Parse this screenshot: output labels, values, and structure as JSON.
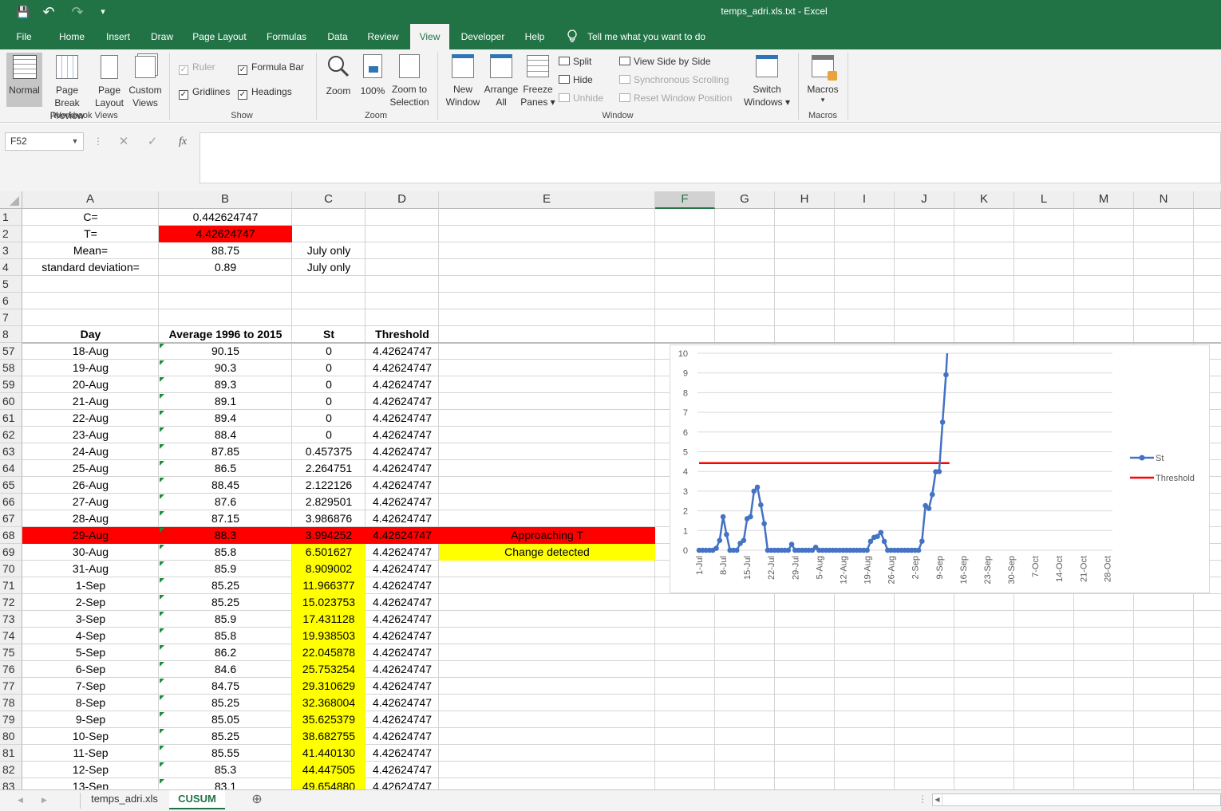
{
  "window": {
    "title": "temps_adri.xls.txt  -  Excel"
  },
  "qat": {
    "save": "💾",
    "undo": "↶",
    "redo": "↷",
    "customize": "▾"
  },
  "tabs": [
    "File",
    "Home",
    "Insert",
    "Draw",
    "Page Layout",
    "Formulas",
    "Data",
    "Review",
    "View",
    "Developer",
    "Help"
  ],
  "tell_me": "Tell me what you want to do",
  "ribbon": {
    "workbook_views": {
      "normal": "Normal",
      "page_break_1": "Page Break",
      "page_break_2": "Preview",
      "page_layout_1": "Page",
      "page_layout_2": "Layout",
      "custom_1": "Custom",
      "custom_2": "Views",
      "label": "Workbook Views"
    },
    "show": {
      "ruler": "Ruler",
      "formula_bar": "Formula Bar",
      "gridlines": "Gridlines",
      "headings": "Headings",
      "label": "Show"
    },
    "zoom": {
      "zoom": "Zoom",
      "hundred": "100%",
      "zoom_sel_1": "Zoom to",
      "zoom_sel_2": "Selection",
      "label": "Zoom"
    },
    "window": {
      "new_1": "New",
      "new_2": "Window",
      "arrange_1": "Arrange",
      "arrange_2": "All",
      "freeze_1": "Freeze",
      "freeze_2": "Panes ▾",
      "split": "Split",
      "hide": "Hide",
      "unhide": "Unhide",
      "side_by_side": "View Side by Side",
      "sync_scroll": "Synchronous Scrolling",
      "reset_pos": "Reset Window Position",
      "switch_1": "Switch",
      "switch_2": "Windows ▾",
      "label": "Window"
    },
    "macros": {
      "macros": "Macros",
      "arrow": "▾",
      "label": "Macros"
    }
  },
  "formula_bar": {
    "name_box": "F52",
    "cancel": "✕",
    "enter": "✓",
    "fx": "fx",
    "value": ""
  },
  "columns": [
    "A",
    "B",
    "C",
    "D",
    "E",
    "F",
    "G",
    "H",
    "I",
    "J",
    "K",
    "L",
    "M",
    "N"
  ],
  "top_rows": [
    {
      "n": "1",
      "a": "C=",
      "b": "0.442624747",
      "c": "",
      "d": ""
    },
    {
      "n": "2",
      "a": "T=",
      "b": "4.42624747",
      "c": "",
      "d": ""
    },
    {
      "n": "3",
      "a": "Mean=",
      "b": "88.75",
      "c": "July only",
      "d": ""
    },
    {
      "n": "4",
      "a": "standard deviation=",
      "b": "0.89",
      "c": "July only",
      "d": ""
    },
    {
      "n": "5",
      "a": "",
      "b": "",
      "c": "",
      "d": ""
    },
    {
      "n": "6",
      "a": "",
      "b": "",
      "c": "",
      "d": ""
    },
    {
      "n": "7",
      "a": "",
      "b": "",
      "c": "",
      "d": ""
    },
    {
      "n": "8",
      "a": "Day",
      "b": "Average 1996 to 2015",
      "c": "St",
      "d": "Threshold"
    }
  ],
  "data_rows": [
    {
      "n": "57",
      "a": "18-Aug",
      "b": "90.15",
      "c": "0",
      "d": "4.42624747",
      "e": ""
    },
    {
      "n": "58",
      "a": "19-Aug",
      "b": "90.3",
      "c": "0",
      "d": "4.42624747",
      "e": ""
    },
    {
      "n": "59",
      "a": "20-Aug",
      "b": "89.3",
      "c": "0",
      "d": "4.42624747",
      "e": ""
    },
    {
      "n": "60",
      "a": "21-Aug",
      "b": "89.1",
      "c": "0",
      "d": "4.42624747",
      "e": ""
    },
    {
      "n": "61",
      "a": "22-Aug",
      "b": "89.4",
      "c": "0",
      "d": "4.42624747",
      "e": ""
    },
    {
      "n": "62",
      "a": "23-Aug",
      "b": "88.4",
      "c": "0",
      "d": "4.42624747",
      "e": ""
    },
    {
      "n": "63",
      "a": "24-Aug",
      "b": "87.85",
      "c": "0.457375",
      "d": "4.42624747",
      "e": ""
    },
    {
      "n": "64",
      "a": "25-Aug",
      "b": "86.5",
      "c": "2.264751",
      "d": "4.42624747",
      "e": ""
    },
    {
      "n": "65",
      "a": "26-Aug",
      "b": "88.45",
      "c": "2.122126",
      "d": "4.42624747",
      "e": ""
    },
    {
      "n": "66",
      "a": "27-Aug",
      "b": "87.6",
      "c": "2.829501",
      "d": "4.42624747",
      "e": ""
    },
    {
      "n": "67",
      "a": "28-Aug",
      "b": "87.15",
      "c": "3.986876",
      "d": "4.42624747",
      "e": ""
    },
    {
      "n": "68",
      "a": "29-Aug",
      "b": "88.3",
      "c": "3.994252",
      "d": "4.42624747",
      "e": "Approaching T"
    },
    {
      "n": "69",
      "a": "30-Aug",
      "b": "85.8",
      "c": "6.501627",
      "d": "4.42624747",
      "e": "Change detected"
    },
    {
      "n": "70",
      "a": "31-Aug",
      "b": "85.9",
      "c": "8.909002",
      "d": "4.42624747",
      "e": ""
    },
    {
      "n": "71",
      "a": "1-Sep",
      "b": "85.25",
      "c": "11.966377",
      "d": "4.42624747",
      "e": ""
    },
    {
      "n": "72",
      "a": "2-Sep",
      "b": "85.25",
      "c": "15.023753",
      "d": "4.42624747",
      "e": ""
    },
    {
      "n": "73",
      "a": "3-Sep",
      "b": "85.9",
      "c": "17.431128",
      "d": "4.42624747",
      "e": ""
    },
    {
      "n": "74",
      "a": "4-Sep",
      "b": "85.8",
      "c": "19.938503",
      "d": "4.42624747",
      "e": ""
    },
    {
      "n": "75",
      "a": "5-Sep",
      "b": "86.2",
      "c": "22.045878",
      "d": "4.42624747",
      "e": ""
    },
    {
      "n": "76",
      "a": "6-Sep",
      "b": "84.6",
      "c": "25.753254",
      "d": "4.42624747",
      "e": ""
    },
    {
      "n": "77",
      "a": "7-Sep",
      "b": "84.75",
      "c": "29.310629",
      "d": "4.42624747",
      "e": ""
    },
    {
      "n": "78",
      "a": "8-Sep",
      "b": "85.25",
      "c": "32.368004",
      "d": "4.42624747",
      "e": ""
    },
    {
      "n": "79",
      "a": "9-Sep",
      "b": "85.05",
      "c": "35.625379",
      "d": "4.42624747",
      "e": ""
    },
    {
      "n": "80",
      "a": "10-Sep",
      "b": "85.25",
      "c": "38.682755",
      "d": "4.42624747",
      "e": ""
    },
    {
      "n": "81",
      "a": "11-Sep",
      "b": "85.55",
      "c": "41.440130",
      "d": "4.42624747",
      "e": ""
    },
    {
      "n": "82",
      "a": "12-Sep",
      "b": "85.3",
      "c": "44.447505",
      "d": "4.42624747",
      "e": ""
    },
    {
      "n": "83",
      "a": "13-Sep",
      "b": "83.1",
      "c": "49.654880",
      "d": "4.42624747",
      "e": ""
    }
  ],
  "colors": {
    "excel_green": "#217346",
    "red_fill": "#ff0000",
    "yellow_fill": "#ffff00",
    "st_line": "#4472c4",
    "threshold_line": "#ff0000"
  },
  "chart_data": {
    "type": "line",
    "title": "",
    "xlabel": "",
    "ylabel": "",
    "ylim": [
      0,
      10
    ],
    "yticks": [
      "0",
      "1",
      "2",
      "3",
      "4",
      "5",
      "6",
      "7",
      "8",
      "9",
      "10"
    ],
    "xticks": [
      "1-Jul",
      "8-Jul",
      "15-Jul",
      "22-Jul",
      "29-Jul",
      "5-Aug",
      "12-Aug",
      "19-Aug",
      "26-Aug",
      "2-Sep",
      "9-Sep",
      "16-Sep",
      "23-Sep",
      "30-Sep",
      "7-Oct",
      "14-Oct",
      "21-Oct",
      "28-Oct"
    ],
    "legend_position": "right",
    "series": [
      {
        "name": "St",
        "marker": "circle",
        "values": [
          0,
          0,
          0,
          0,
          0,
          0.1,
          0.5,
          1.7,
          0.8,
          0,
          0,
          0,
          0.35,
          0.5,
          1.6,
          1.7,
          3,
          3.2,
          2.3,
          1.35,
          0,
          0,
          0,
          0,
          0,
          0,
          0,
          0.3,
          0,
          0,
          0,
          0,
          0,
          0,
          0.15,
          0,
          0,
          0,
          0,
          0,
          0,
          0,
          0,
          0,
          0,
          0,
          0,
          0,
          0,
          0,
          0.45,
          0.65,
          0.7,
          0.9,
          0.45,
          0,
          0,
          0,
          0,
          0,
          0,
          0,
          0,
          0,
          0,
          0.457375,
          2.264751,
          2.122126,
          2.829501,
          3.986876,
          3.994252,
          6.501627,
          8.909002,
          11.966377
        ]
      },
      {
        "name": "Threshold",
        "values": [
          4.42624747,
          4.42624747,
          4.42624747,
          4.42624747,
          4.42624747,
          4.42624747,
          4.42624747,
          4.42624747,
          4.42624747,
          4.42624747,
          4.42624747,
          4.42624747,
          4.42624747,
          4.42624747,
          4.42624747,
          4.42624747,
          4.42624747,
          4.42624747,
          4.42624747,
          4.42624747,
          4.42624747,
          4.42624747,
          4.42624747,
          4.42624747,
          4.42624747,
          4.42624747,
          4.42624747,
          4.42624747,
          4.42624747,
          4.42624747,
          4.42624747,
          4.42624747,
          4.42624747,
          4.42624747,
          4.42624747,
          4.42624747,
          4.42624747,
          4.42624747,
          4.42624747,
          4.42624747,
          4.42624747,
          4.42624747,
          4.42624747,
          4.42624747,
          4.42624747,
          4.42624747,
          4.42624747,
          4.42624747,
          4.42624747,
          4.42624747,
          4.42624747,
          4.42624747,
          4.42624747,
          4.42624747,
          4.42624747,
          4.42624747,
          4.42624747,
          4.42624747,
          4.42624747,
          4.42624747,
          4.42624747,
          4.42624747,
          4.42624747,
          4.42624747,
          4.42624747,
          4.42624747,
          4.42624747,
          4.42624747,
          4.42624747,
          4.42624747,
          4.42624747,
          4.42624747,
          4.42624747,
          4.42624747
        ]
      }
    ]
  },
  "sheets": {
    "tab1": "temps_adri.xls",
    "tab2": "CUSUM",
    "add": "⊕"
  },
  "nav": {
    "prev": "◀",
    "next": "▶"
  }
}
